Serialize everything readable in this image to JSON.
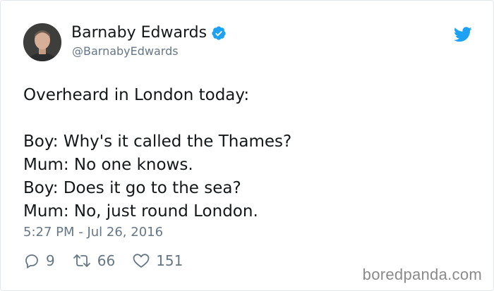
{
  "tweet": {
    "author_name": "Barnaby Edwards",
    "handle": "@BarnabyEdwards",
    "verified": true,
    "lines": [
      "Overheard in London today:",
      "",
      "Boy: Why's it called the Thames?",
      "Mum: No one knows.",
      "Boy: Does it go to the sea?",
      "Mum: No, just round London."
    ],
    "timestamp": "5:27 PM - Jul 26, 2016",
    "replies": "9",
    "retweets": "66",
    "likes": "151"
  },
  "watermark": "boredpanda.com",
  "icons": {
    "verified": "verified-badge-icon",
    "brand": "twitter-bird-icon",
    "reply": "reply-icon",
    "retweet": "retweet-icon",
    "like": "heart-icon"
  },
  "colors": {
    "text": "#14171a",
    "secondary": "#657786",
    "twitter_blue": "#1da1f2",
    "border": "#e1e8ed"
  }
}
